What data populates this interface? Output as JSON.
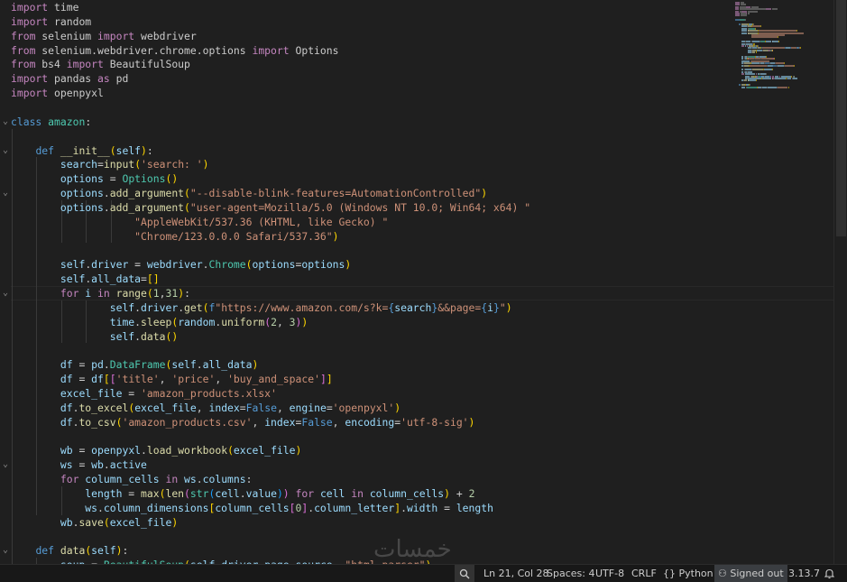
{
  "editor": {
    "language": "python",
    "fold_markers": [
      {
        "line": 9,
        "symbol": "⌄"
      },
      {
        "line": 11,
        "symbol": "⌄"
      },
      {
        "line": 14,
        "symbol": "⌄"
      },
      {
        "line": 21,
        "symbol": "⌄"
      },
      {
        "line": 33,
        "symbol": "⌄"
      },
      {
        "line": 39,
        "symbol": "⌄"
      }
    ],
    "lines": [
      [
        [
          "k",
          "import"
        ],
        [
          "p",
          " time"
        ]
      ],
      [
        [
          "k",
          "import"
        ],
        [
          "p",
          " random"
        ]
      ],
      [
        [
          "k",
          "from"
        ],
        [
          "p",
          " selenium "
        ],
        [
          "k",
          "import"
        ],
        [
          "p",
          " webdriver"
        ]
      ],
      [
        [
          "k",
          "from"
        ],
        [
          "p",
          " selenium.webdriver.chrome.options "
        ],
        [
          "k",
          "import"
        ],
        [
          "p",
          " Options"
        ]
      ],
      [
        [
          "k",
          "from"
        ],
        [
          "p",
          " bs4 "
        ],
        [
          "k",
          "import"
        ],
        [
          "p",
          " BeautifulSoup"
        ]
      ],
      [
        [
          "k",
          "import"
        ],
        [
          "p",
          " pandas "
        ],
        [
          "k",
          "as"
        ],
        [
          "p",
          " pd"
        ]
      ],
      [
        [
          "k",
          "import"
        ],
        [
          "p",
          " openpyxl"
        ]
      ],
      [],
      [
        [
          "sk",
          "class"
        ],
        [
          "c",
          " amazon"
        ],
        [
          "p",
          ":"
        ]
      ],
      [],
      [
        [
          "p",
          "    "
        ],
        [
          "sk",
          "def"
        ],
        [
          "f",
          " __init__"
        ],
        [
          "b1",
          "("
        ],
        [
          "v",
          "self"
        ],
        [
          "b1",
          ")"
        ],
        [
          "p",
          ":"
        ]
      ],
      [
        [
          "p",
          "        "
        ],
        [
          "v",
          "search"
        ],
        [
          "p",
          "="
        ],
        [
          "f",
          "input"
        ],
        [
          "b1",
          "("
        ],
        [
          "s",
          "'search: '"
        ],
        [
          "b1",
          ")"
        ]
      ],
      [
        [
          "p",
          "        "
        ],
        [
          "v",
          "options"
        ],
        [
          "p",
          " = "
        ],
        [
          "c",
          "Options"
        ],
        [
          "b1",
          "()"
        ]
      ],
      [
        [
          "p",
          "        "
        ],
        [
          "v",
          "options"
        ],
        [
          "p",
          "."
        ],
        [
          "f",
          "add_argument"
        ],
        [
          "b1",
          "("
        ],
        [
          "s",
          "\"--disable-blink-features=AutomationControlled\""
        ],
        [
          "b1",
          ")"
        ]
      ],
      [
        [
          "p",
          "        "
        ],
        [
          "v",
          "options"
        ],
        [
          "p",
          "."
        ],
        [
          "f",
          "add_argument"
        ],
        [
          "b1",
          "("
        ],
        [
          "s",
          "\"user-agent=Mozilla/5.0 (Windows NT 10.0; Win64; x64) \""
        ]
      ],
      [
        [
          "p",
          "                    "
        ],
        [
          "s",
          "\"AppleWebKit/537.36 (KHTML, like Gecko) \""
        ]
      ],
      [
        [
          "p",
          "                    "
        ],
        [
          "s",
          "\"Chrome/123.0.0.0 Safari/537.36\""
        ],
        [
          "b1",
          ")"
        ]
      ],
      [],
      [
        [
          "p",
          "        "
        ],
        [
          "v",
          "self"
        ],
        [
          "p",
          "."
        ],
        [
          "v",
          "driver"
        ],
        [
          "p",
          " = "
        ],
        [
          "v",
          "webdriver"
        ],
        [
          "p",
          "."
        ],
        [
          "c",
          "Chrome"
        ],
        [
          "b1",
          "("
        ],
        [
          "v",
          "options"
        ],
        [
          "p",
          "="
        ],
        [
          "v",
          "options"
        ],
        [
          "b1",
          ")"
        ]
      ],
      [
        [
          "p",
          "        "
        ],
        [
          "v",
          "self"
        ],
        [
          "p",
          "."
        ],
        [
          "v",
          "all_data"
        ],
        [
          "p",
          "="
        ],
        [
          "b1",
          "[]"
        ]
      ],
      [
        [
          "p",
          "        "
        ],
        [
          "k",
          "for"
        ],
        [
          "v",
          " i"
        ],
        [
          "k",
          " in"
        ],
        [
          "f",
          " range"
        ],
        [
          "b1",
          "("
        ],
        [
          "n",
          "1"
        ],
        [
          "p",
          ","
        ],
        [
          "n",
          "31"
        ],
        [
          "b1",
          ")"
        ],
        [
          "p",
          ":"
        ]
      ],
      [
        [
          "p",
          "                "
        ],
        [
          "v",
          "self"
        ],
        [
          "p",
          "."
        ],
        [
          "v",
          "driver"
        ],
        [
          "p",
          "."
        ],
        [
          "f",
          "get"
        ],
        [
          "b1",
          "("
        ],
        [
          "sk",
          "f"
        ],
        [
          "s",
          "\"https://www.amazon.com/s?k="
        ],
        [
          "sk",
          "{"
        ],
        [
          "v",
          "search"
        ],
        [
          "sk",
          "}"
        ],
        [
          "s",
          "&&page="
        ],
        [
          "sk",
          "{"
        ],
        [
          "v",
          "i"
        ],
        [
          "sk",
          "}"
        ],
        [
          "s",
          "\""
        ],
        [
          "b1",
          ")"
        ]
      ],
      [
        [
          "p",
          "                "
        ],
        [
          "v",
          "time"
        ],
        [
          "p",
          "."
        ],
        [
          "f",
          "sleep"
        ],
        [
          "b1",
          "("
        ],
        [
          "v",
          "random"
        ],
        [
          "p",
          "."
        ],
        [
          "f",
          "uniform"
        ],
        [
          "b2",
          "("
        ],
        [
          "n",
          "2"
        ],
        [
          "p",
          ", "
        ],
        [
          "n",
          "3"
        ],
        [
          "b2",
          ")"
        ],
        [
          "b1",
          ")"
        ]
      ],
      [
        [
          "p",
          "                "
        ],
        [
          "v",
          "self"
        ],
        [
          "p",
          "."
        ],
        [
          "f",
          "data"
        ],
        [
          "b1",
          "()"
        ]
      ],
      [],
      [
        [
          "p",
          "        "
        ],
        [
          "v",
          "df"
        ],
        [
          "p",
          " = "
        ],
        [
          "v",
          "pd"
        ],
        [
          "p",
          "."
        ],
        [
          "c",
          "DataFrame"
        ],
        [
          "b1",
          "("
        ],
        [
          "v",
          "self"
        ],
        [
          "p",
          "."
        ],
        [
          "v",
          "all_data"
        ],
        [
          "b1",
          ")"
        ]
      ],
      [
        [
          "p",
          "        "
        ],
        [
          "v",
          "df"
        ],
        [
          "p",
          " = "
        ],
        [
          "v",
          "df"
        ],
        [
          "b1",
          "["
        ],
        [
          "b2",
          "["
        ],
        [
          "s",
          "'title'"
        ],
        [
          "p",
          ", "
        ],
        [
          "s",
          "'price'"
        ],
        [
          "p",
          ", "
        ],
        [
          "s",
          "'buy_and_space'"
        ],
        [
          "b2",
          "]"
        ],
        [
          "b1",
          "]"
        ]
      ],
      [
        [
          "p",
          "        "
        ],
        [
          "v",
          "excel_file"
        ],
        [
          "p",
          " = "
        ],
        [
          "s",
          "'amazon_products.xlsx'"
        ]
      ],
      [
        [
          "p",
          "        "
        ],
        [
          "v",
          "df"
        ],
        [
          "p",
          "."
        ],
        [
          "f",
          "to_excel"
        ],
        [
          "b1",
          "("
        ],
        [
          "v",
          "excel_file"
        ],
        [
          "p",
          ", "
        ],
        [
          "v",
          "index"
        ],
        [
          "p",
          "="
        ],
        [
          "sk",
          "False"
        ],
        [
          "p",
          ", "
        ],
        [
          "v",
          "engine"
        ],
        [
          "p",
          "="
        ],
        [
          "s",
          "'openpyxl'"
        ],
        [
          "b1",
          ")"
        ]
      ],
      [
        [
          "p",
          "        "
        ],
        [
          "v",
          "df"
        ],
        [
          "p",
          "."
        ],
        [
          "f",
          "to_csv"
        ],
        [
          "b1",
          "("
        ],
        [
          "s",
          "'amazon_products.csv'"
        ],
        [
          "p",
          ", "
        ],
        [
          "v",
          "index"
        ],
        [
          "p",
          "="
        ],
        [
          "sk",
          "False"
        ],
        [
          "p",
          ", "
        ],
        [
          "v",
          "encoding"
        ],
        [
          "p",
          "="
        ],
        [
          "s",
          "'utf-8-sig'"
        ],
        [
          "b1",
          ")"
        ]
      ],
      [],
      [
        [
          "p",
          "        "
        ],
        [
          "v",
          "wb"
        ],
        [
          "p",
          " = "
        ],
        [
          "v",
          "openpyxl"
        ],
        [
          "p",
          "."
        ],
        [
          "f",
          "load_workbook"
        ],
        [
          "b1",
          "("
        ],
        [
          "v",
          "excel_file"
        ],
        [
          "b1",
          ")"
        ]
      ],
      [
        [
          "p",
          "        "
        ],
        [
          "v",
          "ws"
        ],
        [
          "p",
          " = "
        ],
        [
          "v",
          "wb"
        ],
        [
          "p",
          "."
        ],
        [
          "v",
          "active"
        ]
      ],
      [
        [
          "p",
          "        "
        ],
        [
          "k",
          "for"
        ],
        [
          "v",
          " column_cells"
        ],
        [
          "k",
          " in"
        ],
        [
          "v",
          " ws"
        ],
        [
          "p",
          "."
        ],
        [
          "v",
          "columns"
        ],
        [
          "p",
          ":"
        ]
      ],
      [
        [
          "p",
          "            "
        ],
        [
          "v",
          "length"
        ],
        [
          "p",
          " = "
        ],
        [
          "f",
          "max"
        ],
        [
          "b1",
          "("
        ],
        [
          "f",
          "len"
        ],
        [
          "b2",
          "("
        ],
        [
          "c",
          "str"
        ],
        [
          "b3",
          "("
        ],
        [
          "v",
          "cell"
        ],
        [
          "p",
          "."
        ],
        [
          "v",
          "value"
        ],
        [
          "b3",
          ")"
        ],
        [
          "b2",
          ")"
        ],
        [
          "k",
          " for"
        ],
        [
          "v",
          " cell"
        ],
        [
          "k",
          " in"
        ],
        [
          "v",
          " column_cells"
        ],
        [
          "b1",
          ")"
        ],
        [
          "p",
          " + "
        ],
        [
          "n",
          "2"
        ]
      ],
      [
        [
          "p",
          "            "
        ],
        [
          "v",
          "ws"
        ],
        [
          "p",
          "."
        ],
        [
          "v",
          "column_dimensions"
        ],
        [
          "b1",
          "["
        ],
        [
          "v",
          "column_cells"
        ],
        [
          "b2",
          "["
        ],
        [
          "n",
          "0"
        ],
        [
          "b2",
          "]"
        ],
        [
          "p",
          "."
        ],
        [
          "v",
          "column_letter"
        ],
        [
          "b1",
          "]"
        ],
        [
          "p",
          "."
        ],
        [
          "v",
          "width"
        ],
        [
          "p",
          " = "
        ],
        [
          "v",
          "length"
        ]
      ],
      [
        [
          "p",
          "        "
        ],
        [
          "v",
          "wb"
        ],
        [
          "p",
          "."
        ],
        [
          "f",
          "save"
        ],
        [
          "b1",
          "("
        ],
        [
          "v",
          "excel_file"
        ],
        [
          "b1",
          ")"
        ]
      ],
      [],
      [
        [
          "p",
          "    "
        ],
        [
          "sk",
          "def"
        ],
        [
          "f",
          " data"
        ],
        [
          "b1",
          "("
        ],
        [
          "v",
          "self"
        ],
        [
          "b1",
          ")"
        ],
        [
          "p",
          ":"
        ]
      ],
      [
        [
          "p",
          "        "
        ],
        [
          "v",
          "soup"
        ],
        [
          "p",
          " = "
        ],
        [
          "c",
          "BeautifulSoup"
        ],
        [
          "b1",
          "("
        ],
        [
          "v",
          "self"
        ],
        [
          "p",
          "."
        ],
        [
          "v",
          "driver"
        ],
        [
          "p",
          "."
        ],
        [
          "v",
          "page_source"
        ],
        [
          "p",
          ", "
        ],
        [
          "s",
          "\"html.parser\""
        ],
        [
          "b1",
          ")"
        ]
      ]
    ],
    "current_line": 21,
    "colors": {
      "background": "#1f1f1f",
      "keyword": "#c586c0",
      "storage": "#569cd6",
      "function": "#dcdcaa",
      "string": "#ce9178",
      "variable": "#9cdcfe",
      "class": "#4ec9b0",
      "number": "#b5cea8"
    }
  },
  "watermark": {
    "text": "خمسات"
  },
  "statusbar": {
    "zoom_icon": "zoom-icon",
    "position": "Ln 21, Col 28",
    "spaces": "Spaces: 4",
    "encoding": "UTF-8",
    "line_ending": "CRLF",
    "language_icon": "braces-icon",
    "language": "Python",
    "account_icon": "person-icon",
    "account": "Signed out",
    "python_version": "3.13.7",
    "notifications_icon": "bell-icon"
  }
}
